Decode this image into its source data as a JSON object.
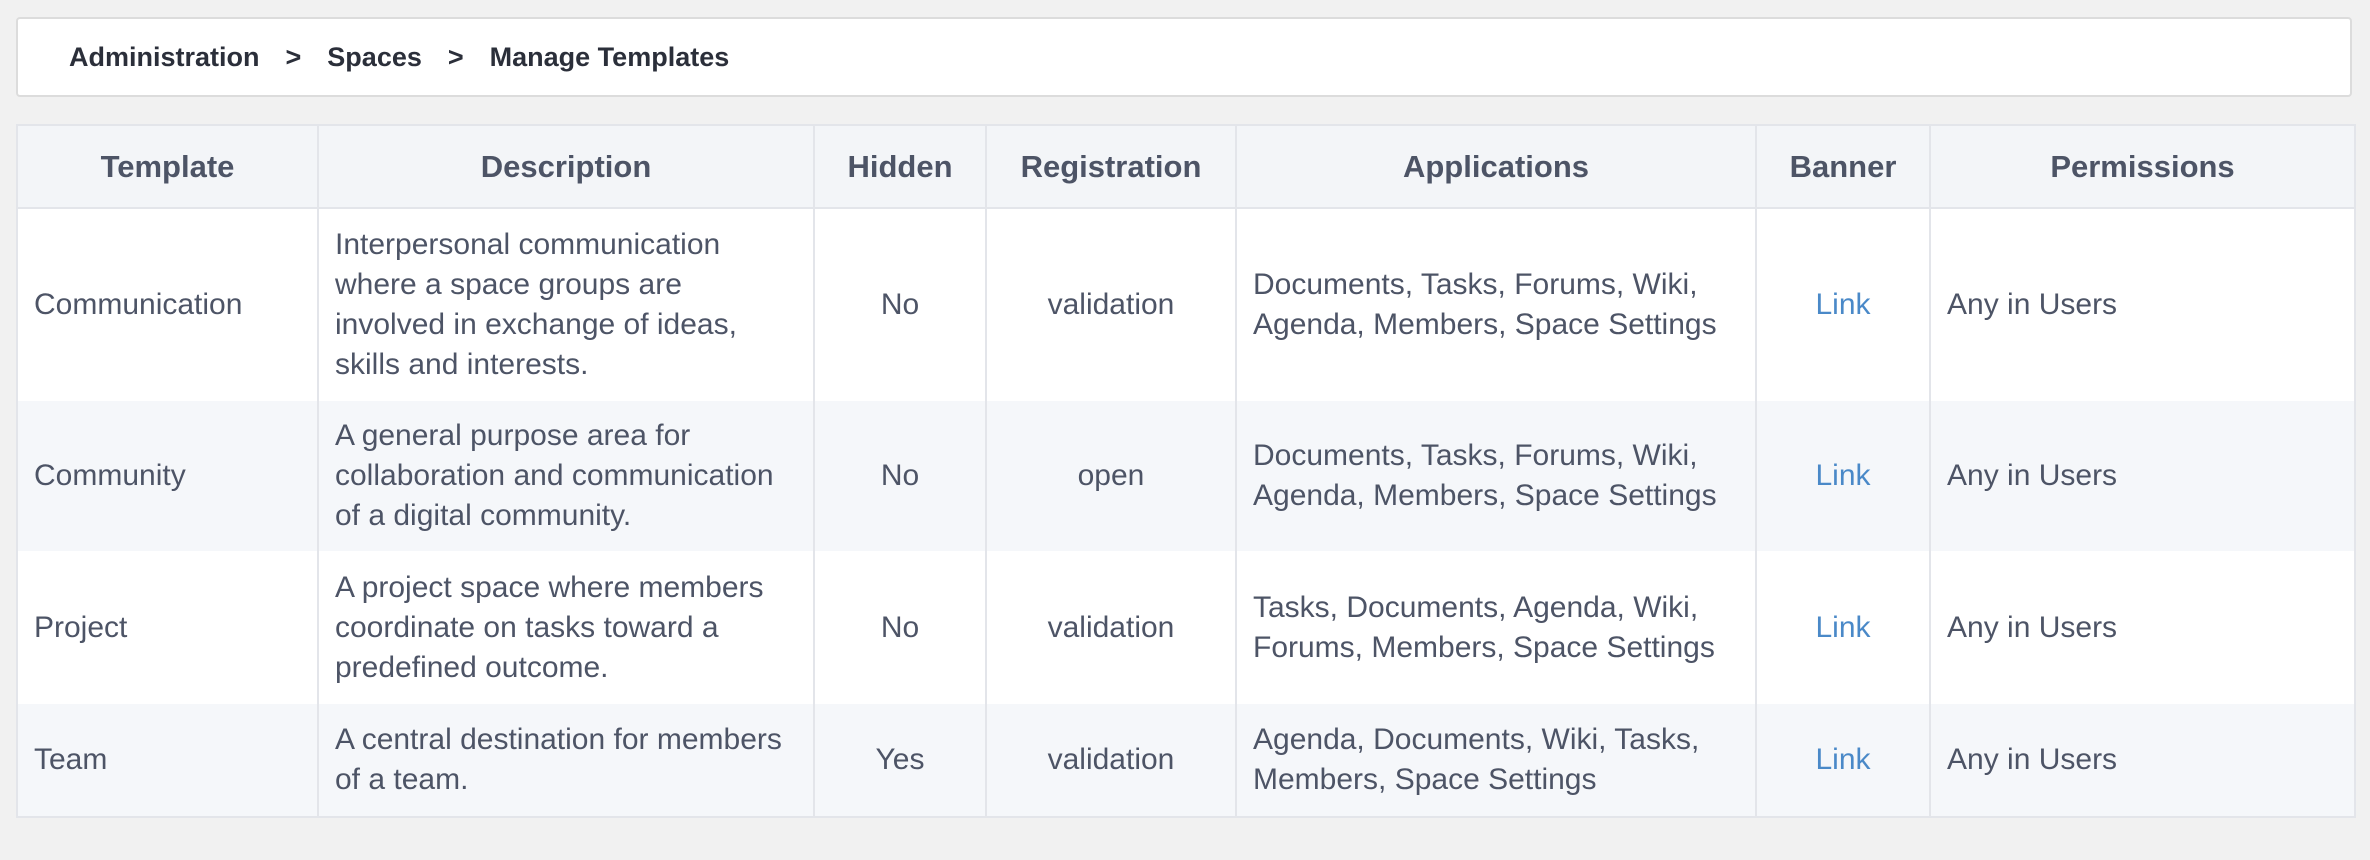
{
  "breadcrumb": {
    "items": [
      "Administration",
      "Spaces",
      "Manage Templates"
    ],
    "separator": ">"
  },
  "table": {
    "headers": {
      "template": "Template",
      "description": "Description",
      "hidden": "Hidden",
      "registration": "Registration",
      "applications": "Applications",
      "banner": "Banner",
      "permissions": "Permissions"
    },
    "rows": [
      {
        "template": "Communication",
        "description": "Interpersonal communication where a space groups are involved in exchange of ideas, skills and interests.",
        "hidden": "No",
        "registration": "validation",
        "applications": "Documents, Tasks, Forums, Wiki, Agenda, Members, Space Settings",
        "banner": "Link",
        "permissions": "Any in Users"
      },
      {
        "template": "Community",
        "description": "A general purpose area for collaboration and communication of a digital community.",
        "hidden": "No",
        "registration": "open",
        "applications": "Documents, Tasks, Forums, Wiki, Agenda, Members, Space Settings",
        "banner": "Link",
        "permissions": "Any in Users"
      },
      {
        "template": "Project",
        "description": "A project space where members coordinate on tasks toward a predefined outcome.",
        "hidden": "No",
        "registration": "validation",
        "applications": "Tasks, Documents, Agenda, Wiki, Forums, Members, Space Settings",
        "banner": "Link",
        "permissions": "Any in Users"
      },
      {
        "template": "Team",
        "description": "A central destination for members of a team.",
        "hidden": "Yes",
        "registration": "validation",
        "applications": "Agenda, Documents, Wiki, Tasks, Members, Space Settings",
        "banner": "Link",
        "permissions": "Any in Users"
      }
    ]
  },
  "colors": {
    "link": "#4a89c8",
    "header_bg": "#f3f5f8",
    "stripe_bg": "#f5f7fa",
    "text": "#4d5466"
  }
}
